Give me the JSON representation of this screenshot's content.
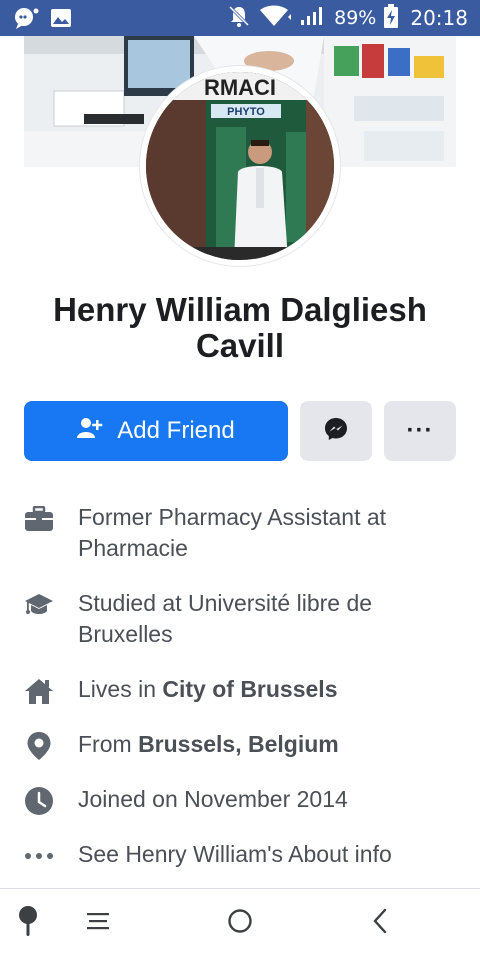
{
  "status_bar": {
    "battery": "89%",
    "time": "20:18",
    "icons": [
      "chat-notification-icon",
      "image-notification-icon",
      "mute-icon",
      "wifi-icon",
      "signal-icon",
      "battery-charging-icon"
    ]
  },
  "profile": {
    "name": "Henry William Dalgliesh Cavill",
    "cover_sign_text": "RMACI",
    "avatar_sign_text": "RMACI",
    "avatar_sub_sign": "PHYTO"
  },
  "actions": {
    "add_friend_label": "Add Friend",
    "message_icon": "messenger-icon",
    "more_label": "···"
  },
  "info": [
    {
      "icon": "briefcase-icon",
      "prefix": "Former Pharmacy Assistant at Pharmacie",
      "bold": ""
    },
    {
      "icon": "graduation-cap-icon",
      "prefix": "Studied at Université libre de Bruxelles",
      "bold": ""
    },
    {
      "icon": "home-icon",
      "prefix": "Lives in ",
      "bold": "City of Brussels"
    },
    {
      "icon": "location-pin-icon",
      "prefix": "From ",
      "bold": "Brussels, Belgium"
    },
    {
      "icon": "clock-icon",
      "prefix": "Joined on November 2014",
      "bold": ""
    },
    {
      "icon": "more-dots-icon",
      "prefix": "See Henry William's About info",
      "bold": ""
    }
  ],
  "colors": {
    "status_bar": "#3a5ba0",
    "primary": "#1877f2",
    "secondary_button": "#e4e6eb",
    "info_text": "#4b4f56"
  }
}
